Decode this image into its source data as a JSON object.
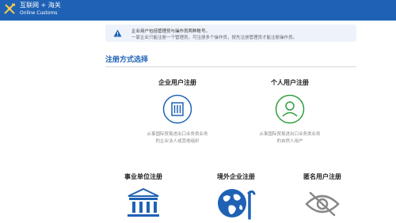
{
  "header": {
    "brand_cn": "互联网 + 海关",
    "brand_en": "Online Customs",
    "logo_icon": "customs-emblem-icon"
  },
  "notice": {
    "line1": "企业用户包括管理员与操作员两种账号。",
    "line2": "一家企业只能注册一个管理员，可注册多个操作员，按先注册管理员才能注册操作员。",
    "icon": "warning-triangle-icon"
  },
  "section": {
    "title": "注册方式选择"
  },
  "options": [
    {
      "title": "企业用户注册",
      "desc_line1": "从事国际贸易进出口业务类业务",
      "desc_line2": "的企业法人或其他组织",
      "icon": "building-icon",
      "color": "#1f62b5"
    },
    {
      "title": "个人用户注册",
      "desc_line1": "从事国际贸易进出口业务类业务",
      "desc_line2": "的自然人用户",
      "icon": "person-icon",
      "color": "#2e9e3f"
    },
    {
      "title": "事业单位注册",
      "icon": "institution-icon",
      "color": "#1f62b5"
    },
    {
      "title": "境外企业注册",
      "icon": "globe-icon",
      "color": "#1f62b5"
    },
    {
      "title": "匿名用户注册",
      "icon": "eye-slash-icon",
      "color": "#888888"
    }
  ]
}
